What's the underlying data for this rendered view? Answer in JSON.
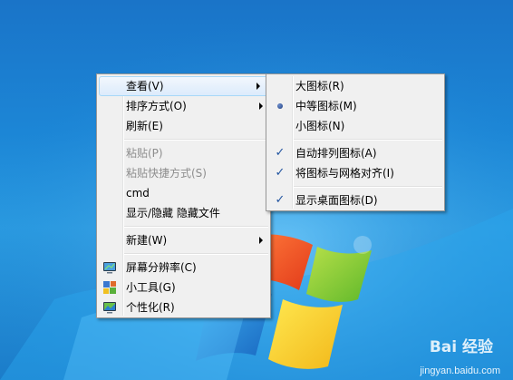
{
  "main_menu": {
    "items": [
      {
        "label": "查看(V)",
        "submenu": true,
        "highlighted": true
      },
      {
        "label": "排序方式(O)",
        "submenu": true
      },
      {
        "label": "刷新(E)"
      },
      {
        "label": "粘贴(P)",
        "disabled": true
      },
      {
        "label": "粘贴快捷方式(S)",
        "disabled": true
      },
      {
        "label": "cmd"
      },
      {
        "label": "显示/隐藏 隐藏文件"
      },
      {
        "label": "新建(W)",
        "submenu": true
      },
      {
        "label": "屏幕分辨率(C)",
        "icon": "screen-resolution-icon"
      },
      {
        "label": "小工具(G)",
        "icon": "gadgets-icon"
      },
      {
        "label": "个性化(R)",
        "icon": "personalize-icon"
      }
    ]
  },
  "view_submenu": {
    "items": [
      {
        "label": "大图标(R)"
      },
      {
        "label": "中等图标(M)",
        "selected": true
      },
      {
        "label": "小图标(N)"
      },
      {
        "label": "自动排列图标(A)",
        "checked": true
      },
      {
        "label": "将图标与网格对齐(I)",
        "checked": true
      },
      {
        "label": "显示桌面图标(D)",
        "checked": true
      }
    ]
  },
  "watermark": {
    "brand": "Bai 经验",
    "url": "jingyan.baidu.com"
  },
  "colors": {
    "accent": "#2255a0",
    "desktop": "#1c86d6",
    "menu_bg": "#f0f0f0",
    "hover_border": "#a8d8f8"
  }
}
